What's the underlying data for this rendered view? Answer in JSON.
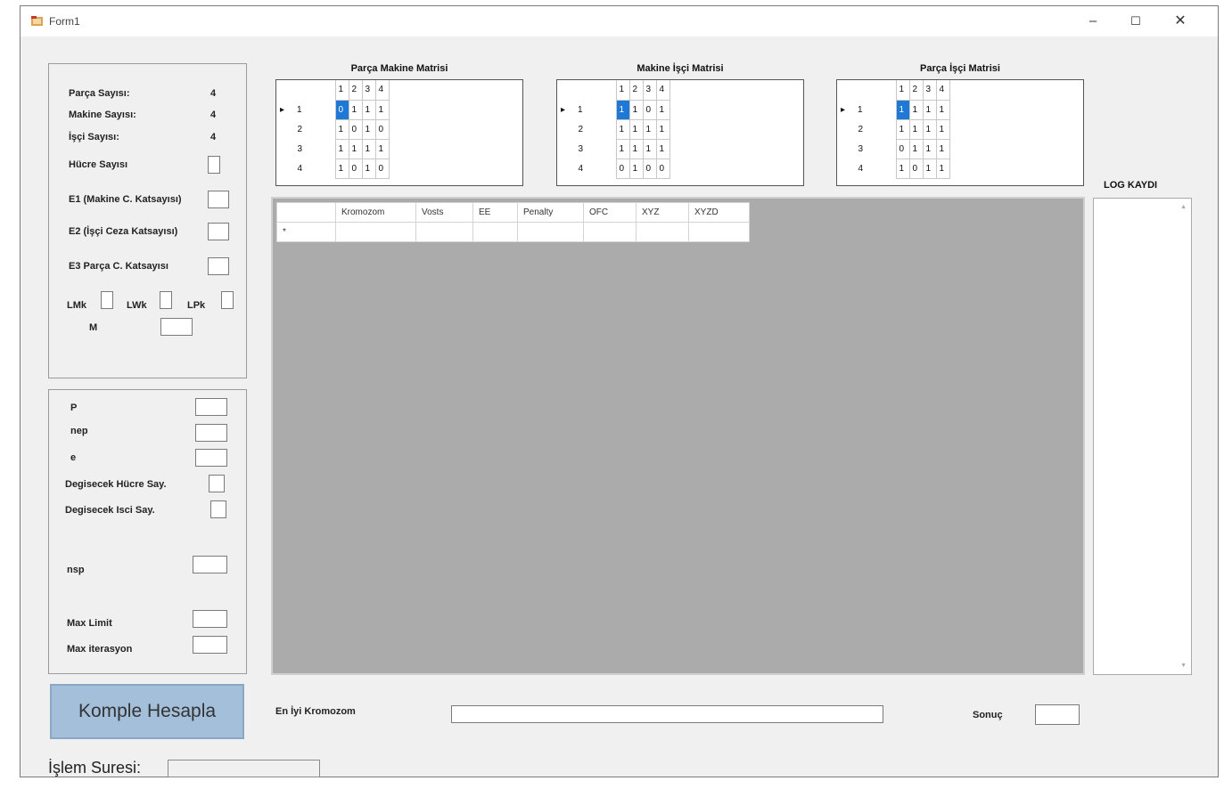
{
  "window": {
    "title": "Form1",
    "min": "–",
    "max": "☐",
    "close": "✕"
  },
  "params": {
    "parca_sayisi_label": "Parça Sayısı:",
    "parca_sayisi": "4",
    "makine_sayisi_label": "Makine Sayısı:",
    "makine_sayisi": "4",
    "isci_sayisi_label": "İşçi Sayısı:",
    "isci_sayisi": "4",
    "hucre_sayisi_label": "Hücre Sayısı",
    "e1_label": "E1 (Makine C. Katsayısı)",
    "e2_label": "E2 (İşçi Ceza Katsayısı)",
    "e3_label": "E3 Parça C. Katsayısı",
    "lmk_label": "LMk",
    "lwk_label": "LWk",
    "lpk_label": "LPk",
    "m_label": "M"
  },
  "params2": {
    "p_label": "P",
    "nep_label": "nep",
    "e_label": "e",
    "deg_hucre_label": "Degisecek Hücre Say.",
    "deg_isci_label": "Degisecek Isci Say.",
    "nsp_label": "nsp",
    "max_limit_label": "Max Limit",
    "max_iter_label": "Max iterasyon"
  },
  "matrices": [
    {
      "title": "Parça Makine Matrisi",
      "headers": [
        "1",
        "2",
        "3",
        "4"
      ],
      "rows": [
        {
          "marker": "▸",
          "id": "1",
          "cells": [
            "0",
            "1",
            "1",
            "1"
          ]
        },
        {
          "marker": "",
          "id": "2",
          "cells": [
            "1",
            "0",
            "1",
            "0"
          ]
        },
        {
          "marker": "",
          "id": "3",
          "cells": [
            "1",
            "1",
            "1",
            "1"
          ]
        },
        {
          "marker": "",
          "id": "4",
          "cells": [
            "1",
            "0",
            "1",
            "0"
          ]
        }
      ]
    },
    {
      "title": "Makine İşçi Matrisi",
      "headers": [
        "1",
        "2",
        "3",
        "4"
      ],
      "rows": [
        {
          "marker": "▸",
          "id": "1",
          "cells": [
            "1",
            "1",
            "0",
            "1"
          ]
        },
        {
          "marker": "",
          "id": "2",
          "cells": [
            "1",
            "1",
            "1",
            "1"
          ]
        },
        {
          "marker": "",
          "id": "3",
          "cells": [
            "1",
            "1",
            "1",
            "1"
          ]
        },
        {
          "marker": "",
          "id": "4",
          "cells": [
            "0",
            "1",
            "0",
            "0"
          ]
        }
      ]
    },
    {
      "title": "Parça İşçi Matrisi",
      "headers": [
        "1",
        "2",
        "3",
        "4"
      ],
      "rows": [
        {
          "marker": "▸",
          "id": "1",
          "cells": [
            "1",
            "1",
            "1",
            "1"
          ]
        },
        {
          "marker": "",
          "id": "2",
          "cells": [
            "1",
            "1",
            "1",
            "1"
          ]
        },
        {
          "marker": "",
          "id": "3",
          "cells": [
            "0",
            "1",
            "1",
            "1"
          ]
        },
        {
          "marker": "",
          "id": "4",
          "cells": [
            "1",
            "0",
            "1",
            "1"
          ]
        }
      ]
    }
  ],
  "main_grid": {
    "columns": [
      "Kromozom",
      "Vosts",
      "EE",
      "Penalty",
      "OFC",
      "XYZ",
      "XYZD"
    ],
    "new_row_marker": "*"
  },
  "log": {
    "label": "LOG KAYDI"
  },
  "footer": {
    "en_iyi_label": "En İyi Kromozom",
    "sonuc_label": "Sonuç",
    "komple_button": "Komple Hesapla",
    "islem_label": "İşlem Suresi:"
  },
  "colors": {
    "selection": "#1e78d6",
    "button_bg": "#a3bfd9",
    "grid_bg": "#ababab"
  }
}
